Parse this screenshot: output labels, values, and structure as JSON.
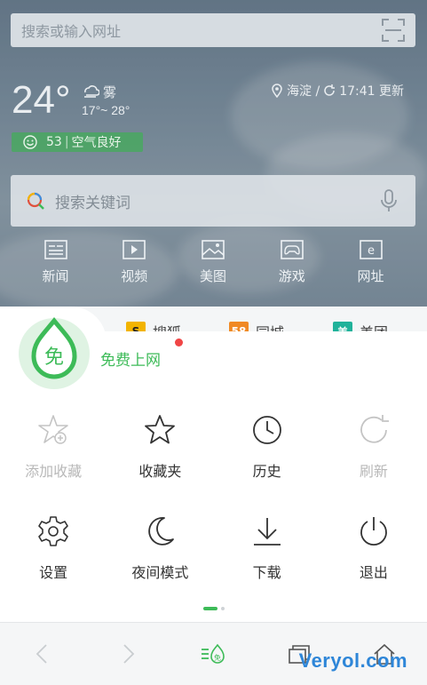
{
  "header": {
    "url_placeholder": "搜索或输入网址"
  },
  "weather": {
    "temperature": "24°",
    "condition": "雾",
    "range": "17°~ 28°",
    "aqi": "53",
    "aqi_label": "空气良好",
    "location": "海淀 /",
    "updated": "17:41 更新"
  },
  "search": {
    "placeholder": "搜索关键词"
  },
  "quick_links": [
    {
      "label": "新闻",
      "icon": "news-icon"
    },
    {
      "label": "视频",
      "icon": "video-icon"
    },
    {
      "label": "美图",
      "icon": "picture-icon"
    },
    {
      "label": "游戏",
      "icon": "game-icon"
    },
    {
      "label": "网址",
      "icon": "url-icon"
    }
  ],
  "cards": [
    {
      "label": "搜狐"
    },
    {
      "label": "同城"
    },
    {
      "label": "美团"
    }
  ],
  "menu": {
    "free_label": "免费上网",
    "badge_char": "免",
    "items": [
      {
        "label": "添加收藏",
        "icon": "add-star-icon",
        "enabled": false
      },
      {
        "label": "收藏夹",
        "icon": "star-icon",
        "enabled": true
      },
      {
        "label": "历史",
        "icon": "clock-icon",
        "enabled": true
      },
      {
        "label": "刷新",
        "icon": "refresh-icon",
        "enabled": false
      },
      {
        "label": "设置",
        "icon": "gear-icon",
        "enabled": true
      },
      {
        "label": "夜间模式",
        "icon": "moon-icon",
        "enabled": true
      },
      {
        "label": "下载",
        "icon": "download-icon",
        "enabled": true
      },
      {
        "label": "退出",
        "icon": "power-icon",
        "enabled": true
      }
    ]
  },
  "bottom_nav": [
    {
      "icon": "back-icon"
    },
    {
      "icon": "forward-icon"
    },
    {
      "icon": "menu-free-icon"
    },
    {
      "icon": "tabs-icon"
    },
    {
      "icon": "home-icon"
    }
  ],
  "watermark": "Veryol.com",
  "colors": {
    "accent": "#3dbb58",
    "notification": "#f04545",
    "watermark": "#2e86d8"
  }
}
